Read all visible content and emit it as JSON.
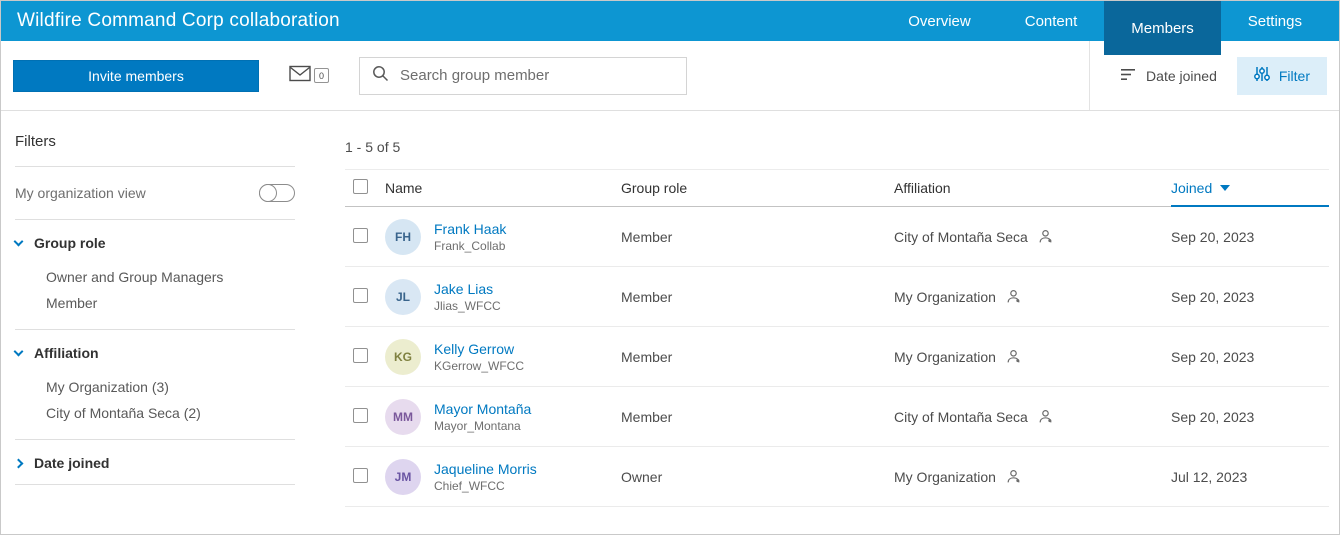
{
  "colors": {
    "accent": "#0079c1",
    "header-bg": "#0d96d2",
    "tab-active": "#0a679b",
    "filter-bg": "#dceef9"
  },
  "header": {
    "title": "Wildfire Command Corp collaboration",
    "tabs": [
      {
        "label": "Overview",
        "active": false
      },
      {
        "label": "Content",
        "active": false
      },
      {
        "label": "Members",
        "active": true
      },
      {
        "label": "Settings",
        "active": false
      }
    ]
  },
  "toolbar": {
    "invite_label": "Invite members",
    "envelope_badge": "0",
    "search_placeholder": "Search group member",
    "sort_label": "Date joined",
    "filter_label": "Filter"
  },
  "sidebar": {
    "title": "Filters",
    "org_view_label": "My organization view",
    "sections": [
      {
        "label": "Group role",
        "expanded": true,
        "items": [
          "Owner and Group Managers",
          "Member"
        ]
      },
      {
        "label": "Affiliation",
        "expanded": true,
        "items": [
          "My Organization (3)",
          "City of Montaña Seca (2)"
        ]
      },
      {
        "label": "Date joined",
        "expanded": false,
        "items": []
      }
    ]
  },
  "main": {
    "count": "1 - 5 of 5",
    "columns": {
      "name": "Name",
      "role": "Group role",
      "affiliation": "Affiliation",
      "joined": "Joined"
    },
    "sorted_column": "Joined",
    "rows": [
      {
        "initials": "FH",
        "avatar_bg": "#d6e6f3",
        "avatar_color": "#39648c",
        "name": "Frank Haak",
        "username": "Frank_Collab",
        "role": "Member",
        "affiliation": "City of Montaña Seca",
        "joined": "Sep 20, 2023"
      },
      {
        "initials": "JL",
        "avatar_bg": "#d9e7f4",
        "avatar_color": "#39648c",
        "name": "Jake Lias",
        "username": "Jlias_WFCC",
        "role": "Member",
        "affiliation": "My Organization",
        "joined": "Sep 20, 2023"
      },
      {
        "initials": "KG",
        "avatar_bg": "#ecedcf",
        "avatar_color": "#7f8140",
        "name": "Kelly Gerrow",
        "username": "KGerrow_WFCC",
        "role": "Member",
        "affiliation": "My Organization",
        "joined": "Sep 20, 2023"
      },
      {
        "initials": "MM",
        "avatar_bg": "#e7dbee",
        "avatar_color": "#7a589b",
        "name": "Mayor Montaña",
        "username": "Mayor_Montana",
        "role": "Member",
        "affiliation": "City of Montaña Seca",
        "joined": "Sep 20, 2023"
      },
      {
        "initials": "JM",
        "avatar_bg": "#ded5ef",
        "avatar_color": "#6a55a3",
        "name": "Jaqueline Morris",
        "username": "Chief_WFCC",
        "role": "Owner",
        "affiliation": "My Organization",
        "joined": "Jul 12, 2023"
      }
    ]
  }
}
